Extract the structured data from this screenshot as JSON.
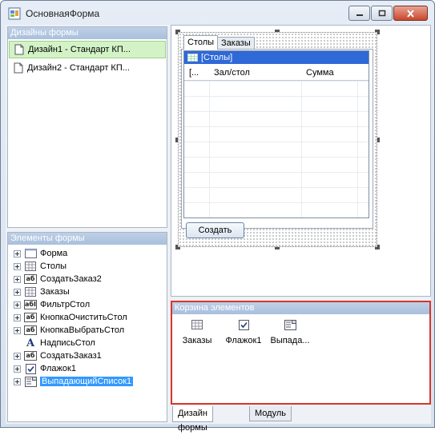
{
  "window": {
    "title": "ОсновнаяФорма",
    "buttons": [
      "minimize",
      "maximize",
      "close"
    ]
  },
  "designs_panel": {
    "header": "Дизайны формы",
    "items": [
      {
        "label": "Дизайн1 - Стандарт КП...",
        "selected": true
      },
      {
        "label": "Дизайн2 - Стандарт КП...",
        "selected": false
      }
    ]
  },
  "elements_panel": {
    "header": "Элементы формы",
    "items": [
      {
        "label": "Форма",
        "icon": "form-icon"
      },
      {
        "label": "Столы",
        "icon": "table-icon"
      },
      {
        "label": "СоздатьЗаказ2",
        "icon": "button-icon"
      },
      {
        "label": "Заказы",
        "icon": "table-icon"
      },
      {
        "label": "ФильтрСтол",
        "icon": "textbox-icon"
      },
      {
        "label": "КнопкаОчиститьСтол",
        "icon": "button-icon"
      },
      {
        "label": "КнопкаВыбратьСтол",
        "icon": "button-icon"
      },
      {
        "label": "НадписьСтол",
        "icon": "label-icon"
      },
      {
        "label": "СоздатьЗаказ1",
        "icon": "button-icon"
      },
      {
        "label": "Флажок1",
        "icon": "checkbox-icon"
      },
      {
        "label": "ВыпадающийСписок1",
        "icon": "dropdown-icon",
        "selected": true
      }
    ]
  },
  "designer": {
    "tabs": [
      "Столы",
      "Заказы"
    ],
    "active_tab": "Столы",
    "grid": {
      "title": "[Столы]",
      "columns": [
        "[...",
        "Зал/стол",
        "Сумма"
      ]
    },
    "create_button": "Создать"
  },
  "basket": {
    "header": "Корзина элементов",
    "items": [
      {
        "label": "Заказы",
        "icon": "table-icon"
      },
      {
        "label": "Флажок1",
        "icon": "checkbox-icon"
      },
      {
        "label": "Выпада...",
        "icon": "dropdown-icon"
      }
    ]
  },
  "bottom_tabs": [
    "Дизайн формы",
    "Модуль"
  ],
  "colors": {
    "panel_header": "#a9bfdc",
    "selected_design": "#d3f3c7",
    "grid_title": "#2f69d8",
    "selection": "#3399ff",
    "basket_border": "#d8352a"
  }
}
